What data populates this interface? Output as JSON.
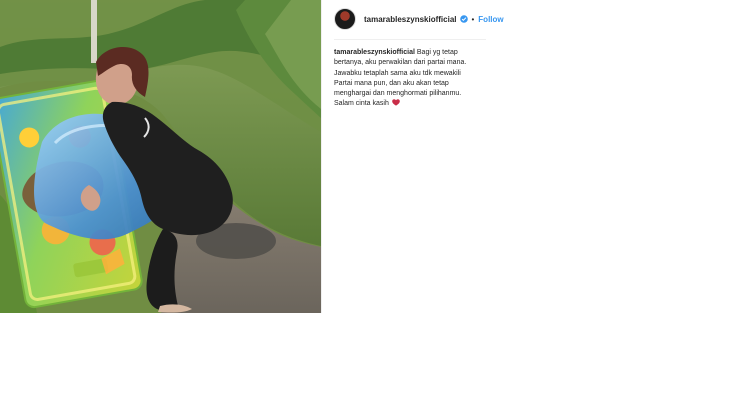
{
  "post": {
    "username": "tamarableszynskiofficial",
    "follow_label": "Follow",
    "caption_username": "tamarableszynskiofficial",
    "caption": "Bagi yg tetap\nbertanya, aku perwakilan dari partai mana.\nJawabku tetaplah sama aku tdk mewakili\nPartai mana pun, dan aku akan tetap\nmenghargai dan menghormati pilihanmu.\nSalam cinta kasih",
    "colors": {
      "follow": "#3897f0",
      "verified": "#3897f0",
      "heart": "#c92d48"
    },
    "icons": {
      "verified": "verified-icon",
      "heart": "heart-icon"
    }
  }
}
